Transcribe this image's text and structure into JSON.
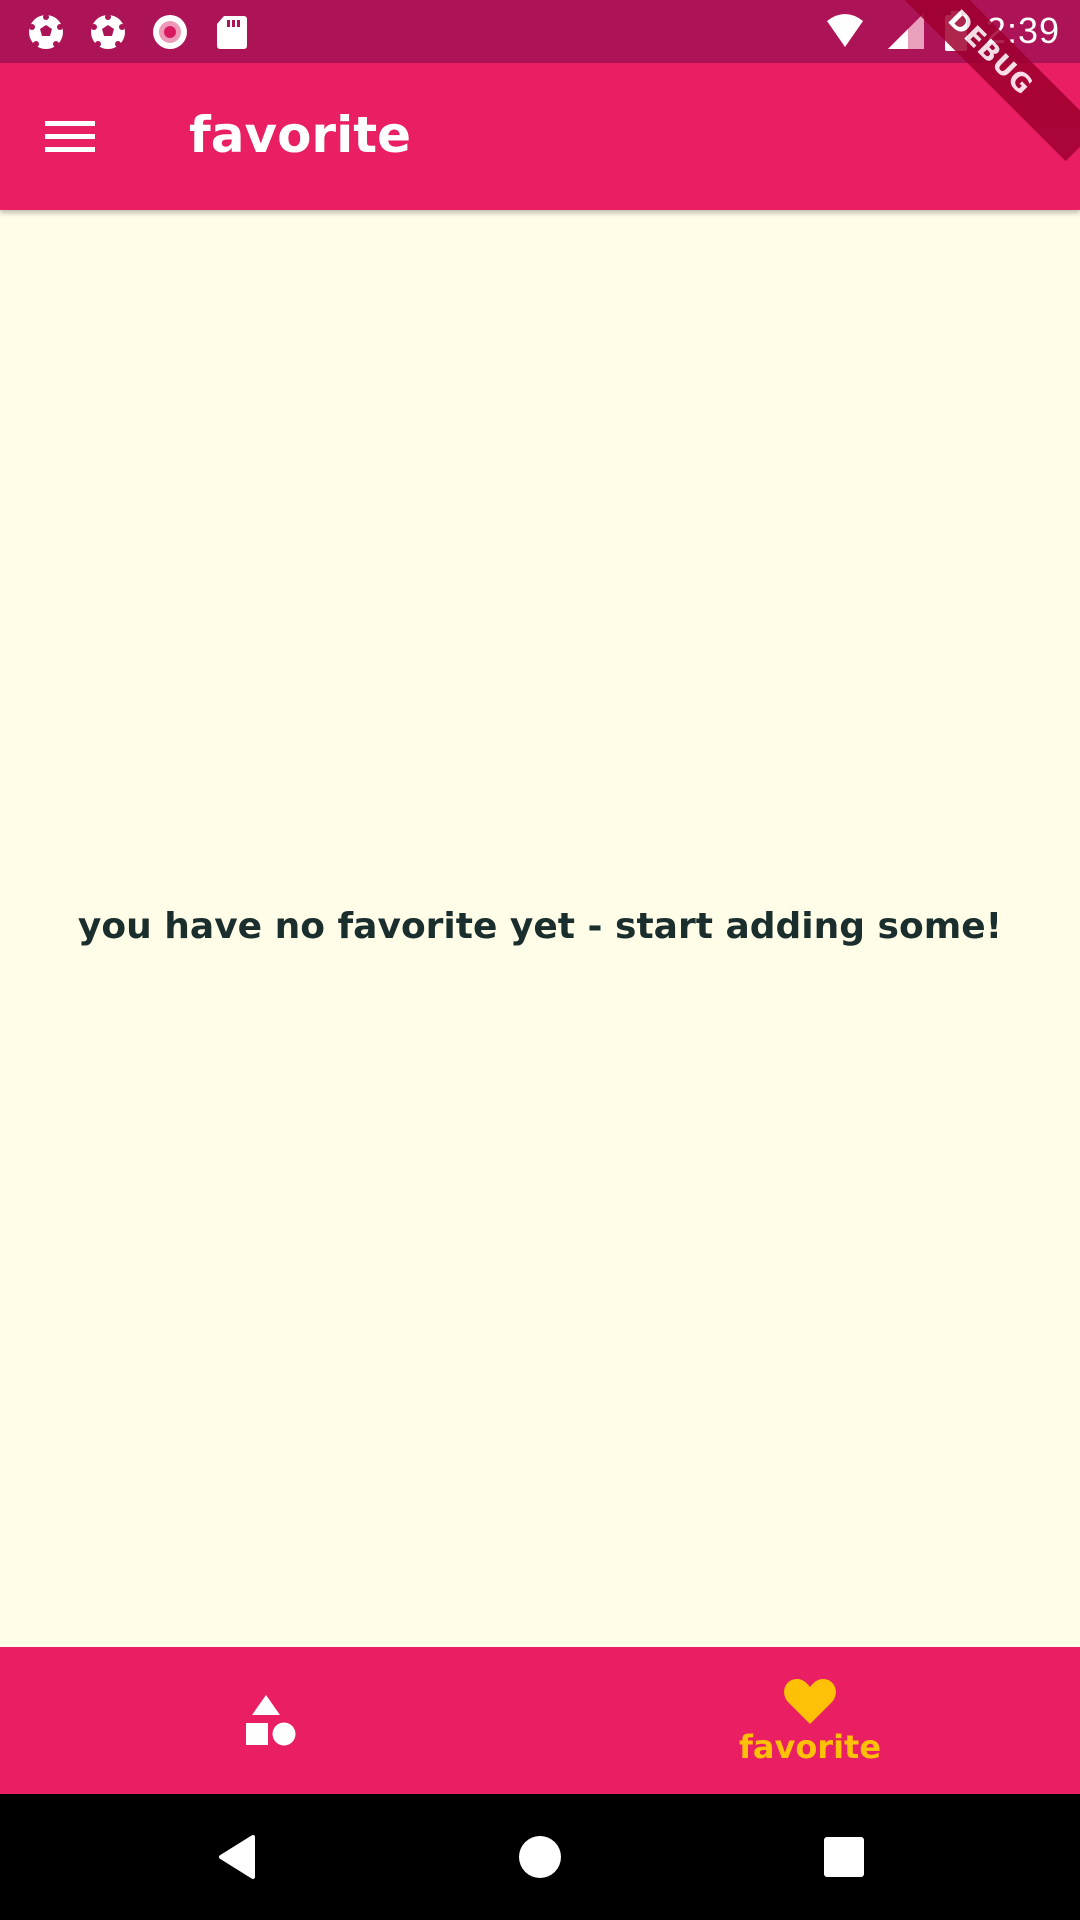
{
  "status_bar": {
    "time": "2:39",
    "left_icons": [
      "soccer-ball-icon",
      "soccer-ball-icon",
      "record-icon",
      "sd-card-icon"
    ],
    "right_icons": [
      "wifi-icon",
      "signal-icon",
      "battery-icon"
    ]
  },
  "debug_banner": {
    "label": "DEBUG"
  },
  "app_bar": {
    "title": "favorite",
    "menu_icon": "hamburger-menu-icon",
    "background": "#e91e63"
  },
  "content": {
    "empty_message": "you have no favorite yet - start adding some!",
    "background": "#fffde7"
  },
  "bottom_nav": {
    "items": [
      {
        "icon": "category-shapes-icon",
        "label": "",
        "selected": false
      },
      {
        "icon": "heart-icon",
        "label": "favorite",
        "selected": true
      }
    ],
    "selected_color": "#ffc107"
  },
  "system_nav": {
    "buttons": [
      "back-icon",
      "home-icon",
      "recents-icon"
    ]
  }
}
